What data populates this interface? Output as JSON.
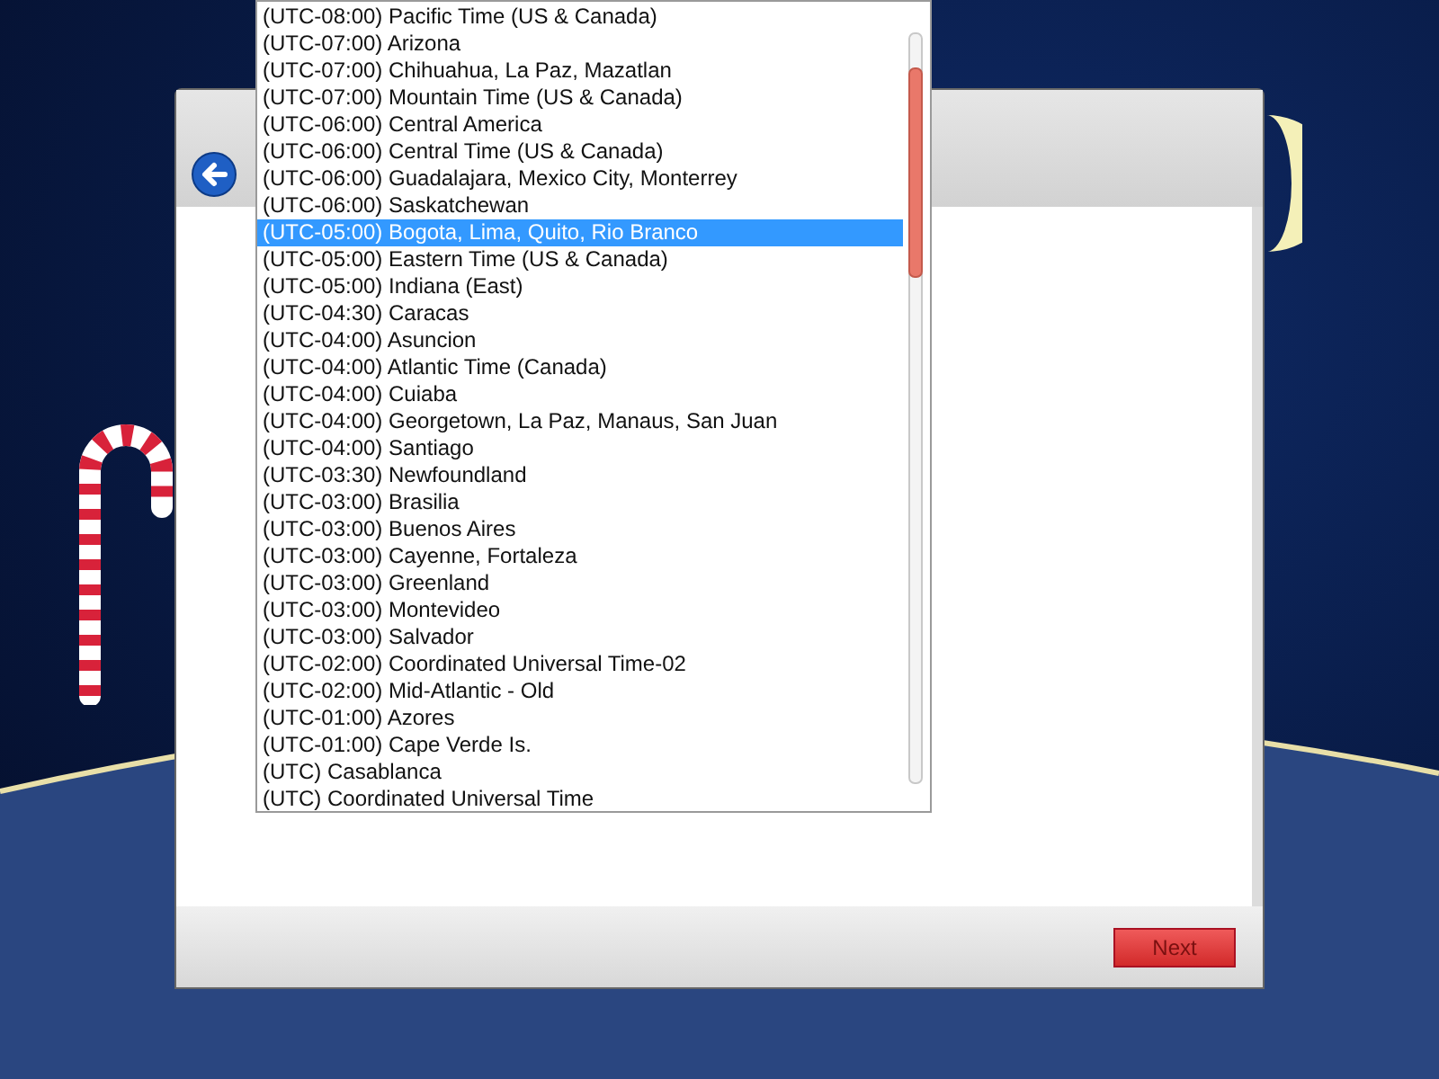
{
  "timezone_list": {
    "items": [
      {
        "label": "(UTC-08:00) Pacific Time (US & Canada)",
        "selected": false
      },
      {
        "label": "(UTC-07:00) Arizona",
        "selected": false
      },
      {
        "label": "(UTC-07:00) Chihuahua, La Paz, Mazatlan",
        "selected": false
      },
      {
        "label": "(UTC-07:00) Mountain Time (US & Canada)",
        "selected": false
      },
      {
        "label": "(UTC-06:00) Central America",
        "selected": false
      },
      {
        "label": "(UTC-06:00) Central Time (US & Canada)",
        "selected": false
      },
      {
        "label": "(UTC-06:00) Guadalajara, Mexico City, Monterrey",
        "selected": false
      },
      {
        "label": "(UTC-06:00) Saskatchewan",
        "selected": false
      },
      {
        "label": "(UTC-05:00) Bogota, Lima, Quito, Rio Branco",
        "selected": true
      },
      {
        "label": "(UTC-05:00) Eastern Time (US & Canada)",
        "selected": false
      },
      {
        "label": "(UTC-05:00) Indiana (East)",
        "selected": false
      },
      {
        "label": "(UTC-04:30) Caracas",
        "selected": false
      },
      {
        "label": "(UTC-04:00) Asuncion",
        "selected": false
      },
      {
        "label": "(UTC-04:00) Atlantic Time (Canada)",
        "selected": false
      },
      {
        "label": "(UTC-04:00) Cuiaba",
        "selected": false
      },
      {
        "label": "(UTC-04:00) Georgetown, La Paz, Manaus, San Juan",
        "selected": false
      },
      {
        "label": "(UTC-04:00) Santiago",
        "selected": false
      },
      {
        "label": "(UTC-03:30) Newfoundland",
        "selected": false
      },
      {
        "label": "(UTC-03:00) Brasilia",
        "selected": false
      },
      {
        "label": "(UTC-03:00) Buenos Aires",
        "selected": false
      },
      {
        "label": "(UTC-03:00) Cayenne, Fortaleza",
        "selected": false
      },
      {
        "label": "(UTC-03:00) Greenland",
        "selected": false
      },
      {
        "label": "(UTC-03:00) Montevideo",
        "selected": false
      },
      {
        "label": "(UTC-03:00) Salvador",
        "selected": false
      },
      {
        "label": "(UTC-02:00) Coordinated Universal Time-02",
        "selected": false
      },
      {
        "label": "(UTC-02:00) Mid-Atlantic - Old",
        "selected": false
      },
      {
        "label": "(UTC-01:00) Azores",
        "selected": false
      },
      {
        "label": "(UTC-01:00) Cape Verde Is.",
        "selected": false
      },
      {
        "label": "(UTC) Casablanca",
        "selected": false
      },
      {
        "label": "(UTC) Coordinated Universal Time",
        "selected": false
      }
    ]
  },
  "buttons": [
    {
      "label": "Next"
    }
  ]
}
